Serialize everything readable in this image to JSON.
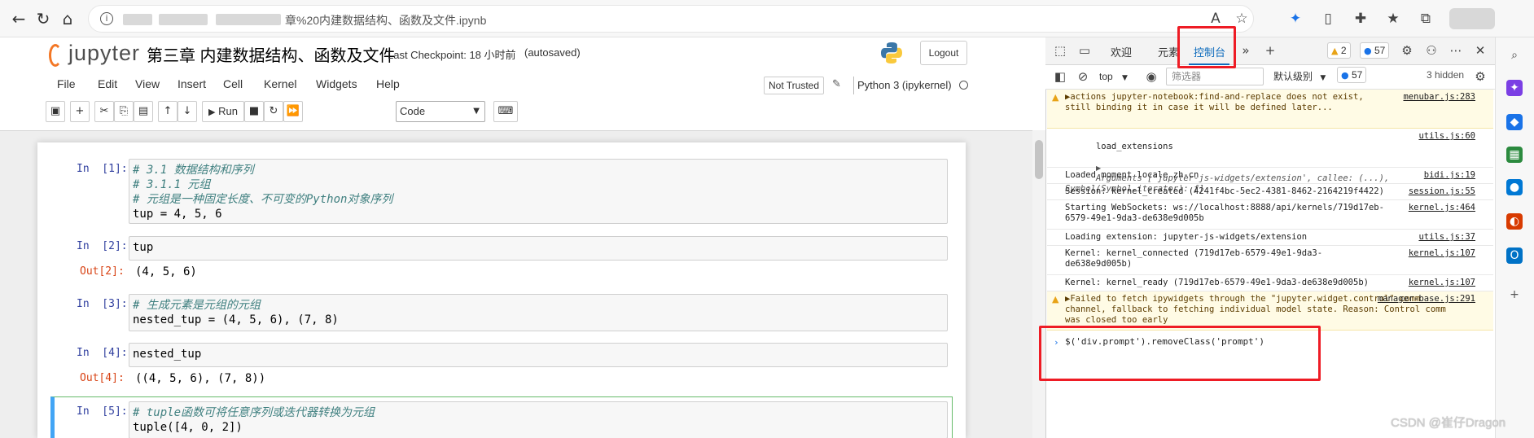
{
  "browser": {
    "url_text": "章%20内建数据结构、函数及文件.ipynb",
    "back_icon": "arrow-left-icon",
    "refresh_icon": "refresh-icon",
    "home_icon": "home-icon"
  },
  "notebook": {
    "logo_text": "jupyter",
    "title": "第三章 内建数据结构、函数及文件",
    "checkpoint": "Last Checkpoint: 18 小时前",
    "autosaved": "(autosaved)",
    "logout": "Logout"
  },
  "menubar": {
    "items": [
      "File",
      "Edit",
      "View",
      "Insert",
      "Cell",
      "Kernel",
      "Widgets",
      "Help"
    ],
    "not_trusted": "Not Trusted",
    "kernel": "Python 3 (ipykernel)"
  },
  "toolbar": {
    "run_label": "Run",
    "cell_type": "Code"
  },
  "cells": [
    {
      "prompt": "In  [1]:",
      "lines": [
        "# 3.1 数据结构和序列",
        "# 3.1.1 元组",
        "# 元组是一种固定长度、不可变的Python对象序列",
        "tup = 4, 5, 6"
      ]
    },
    {
      "prompt": "In  [2]:",
      "lines": [
        "tup"
      ],
      "out_prompt": "Out[2]:",
      "output": "(4, 5, 6)"
    },
    {
      "prompt": "In  [3]:",
      "lines": [
        "# 生成元素是元组的元组",
        "nested_tup = (4, 5, 6), (7, 8)"
      ]
    },
    {
      "prompt": "In  [4]:",
      "lines": [
        "nested_tup"
      ],
      "out_prompt": "Out[4]:",
      "output": "((4, 5, 6), (7, 8))"
    },
    {
      "prompt": "In  [5]:",
      "lines": [
        "# tuple函数可将任意序列或迭代器转换为元组",
        "tuple([4, 0, 2])"
      ]
    }
  ],
  "devtools": {
    "tabs": [
      "欢迎",
      "元素",
      "控制台"
    ],
    "active_tab": "控制台",
    "warn_count": "2",
    "msg_count": "57",
    "context": "top",
    "filter_placeholder": "筛选器",
    "levels": "默认级别",
    "levels_count": "57",
    "hidden": "3 hidden",
    "logs": [
      {
        "level": "warn",
        "text": "▶actions jupyter-notebook:find-and-replace does not exist, still binding it in case it will be defined later...",
        "src": "menubar.js:283"
      },
      {
        "level": "info",
        "text": "load_extensions",
        "args": "Arguments ['jupyter-js-widgets/extension', callee: (...), Symbol(Symbol.iterator): ƒ]",
        "src": "utils.js:60"
      },
      {
        "level": "info",
        "text": "Loaded moment locale zh-cn",
        "src": "bidi.js:19"
      },
      {
        "level": "info",
        "text": "Session: kernel_created (4241f4bc-5ec2-4381-8462-2164219f4422)",
        "src": "session.js:55"
      },
      {
        "level": "info",
        "text": "Starting WebSockets: ws://localhost:8888/api/kernels/719d17eb-6579-49e1-9da3-de638e9d005b",
        "src": "kernel.js:464"
      },
      {
        "level": "info",
        "text": "Loading extension: jupyter-js-widgets/extension",
        "src": "utils.js:37"
      },
      {
        "level": "info",
        "text": "Kernel: kernel_connected (719d17eb-6579-49e1-9da3-de638e9d005b)",
        "src": "kernel.js:107"
      },
      {
        "level": "info",
        "text": "Kernel: kernel_ready (719d17eb-6579-49e1-9da3-de638e9d005b)",
        "src": "kernel.js:107"
      },
      {
        "level": "warn",
        "text": "▶Failed to fetch ipywidgets through the \"jupyter.widget.control\" comm channel, fallback to fetching individual model state. Reason: Control comm was closed too early",
        "src": "manager-base.js:291"
      }
    ],
    "console_input": "$('div.prompt').removeClass('prompt')"
  },
  "watermark": "CSDN @崔仔Dragon",
  "colors": {
    "accent_blue": "#0f6cbd",
    "highlight_red": "#ee1c25",
    "jupyter_orange": "#f37726"
  }
}
